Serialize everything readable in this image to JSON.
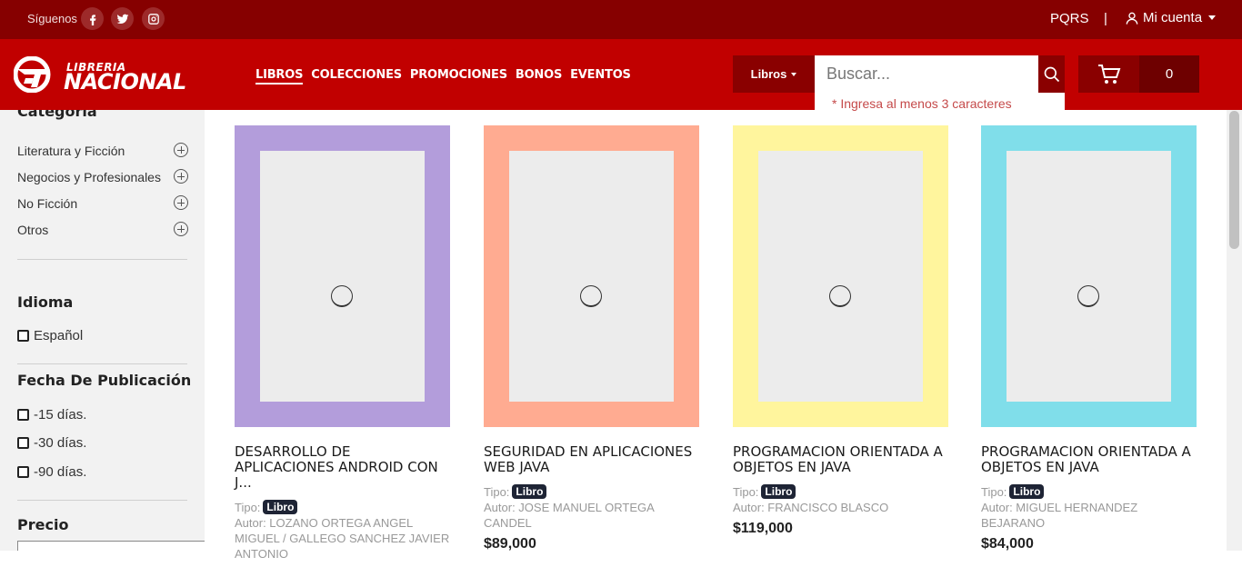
{
  "topbar": {
    "follow_label": "Síguenos",
    "social": [
      "facebook-icon",
      "twitter-icon",
      "instagram-icon"
    ],
    "pqrs": "PQRS",
    "separator": "|",
    "account": "Mi cuenta"
  },
  "header": {
    "logo_top": "LIBRERIA",
    "logo_bottom": "NACIONAL",
    "nav": [
      "LIBROS",
      "COLECCIONES",
      "PROMOCIONES",
      "BONOS",
      "EVENTOS"
    ],
    "search_category": "Libros",
    "search_placeholder": "Buscar...",
    "search_hint": "* Ingresa al menos 3 caracteres",
    "cart_count": "0"
  },
  "sidebar": {
    "category_title": "Categoría",
    "categories": [
      "Literatura y Ficción",
      "Negocios y Profesionales",
      "No Ficción",
      "Otros"
    ],
    "language_title": "Idioma",
    "languages": [
      "Español"
    ],
    "date_title": "Fecha De Publicación",
    "dates": [
      "-15 días.",
      "-30 días.",
      "-90 días."
    ],
    "price_title": "Precio"
  },
  "products": [
    {
      "title": "DESARROLLO DE APLICACIONES ANDROID CON J...",
      "type_label": "Tipo:",
      "type": "Libro",
      "author": "Autor: LOZANO ORTEGA ANGEL MIGUEL / GALLEGO SANCHEZ JAVIER ANTONIO",
      "price": "",
      "cover_color": "#b39ddb"
    },
    {
      "title": "SEGURIDAD EN APLICACIONES WEB JAVA",
      "type_label": "Tipo:",
      "type": "Libro",
      "author": "Autor: JOSE MANUEL ORTEGA CANDEL",
      "price": "$89,000",
      "cover_color": "#ffab91"
    },
    {
      "title": "PROGRAMACION ORIENTADA A OBJETOS EN JAVA",
      "type_label": "Tipo:",
      "type": "Libro",
      "author": "Autor: FRANCISCO BLASCO",
      "price": "$119,000",
      "cover_color": "#fff59d"
    },
    {
      "title": "PROGRAMACION ORIENTADA A OBJETOS EN JAVA",
      "type_label": "Tipo:",
      "type": "Libro",
      "author": "Autor: MIGUEL HERNANDEZ BEJARANO",
      "price": "$84,000",
      "cover_color": "#80deea"
    }
  ]
}
